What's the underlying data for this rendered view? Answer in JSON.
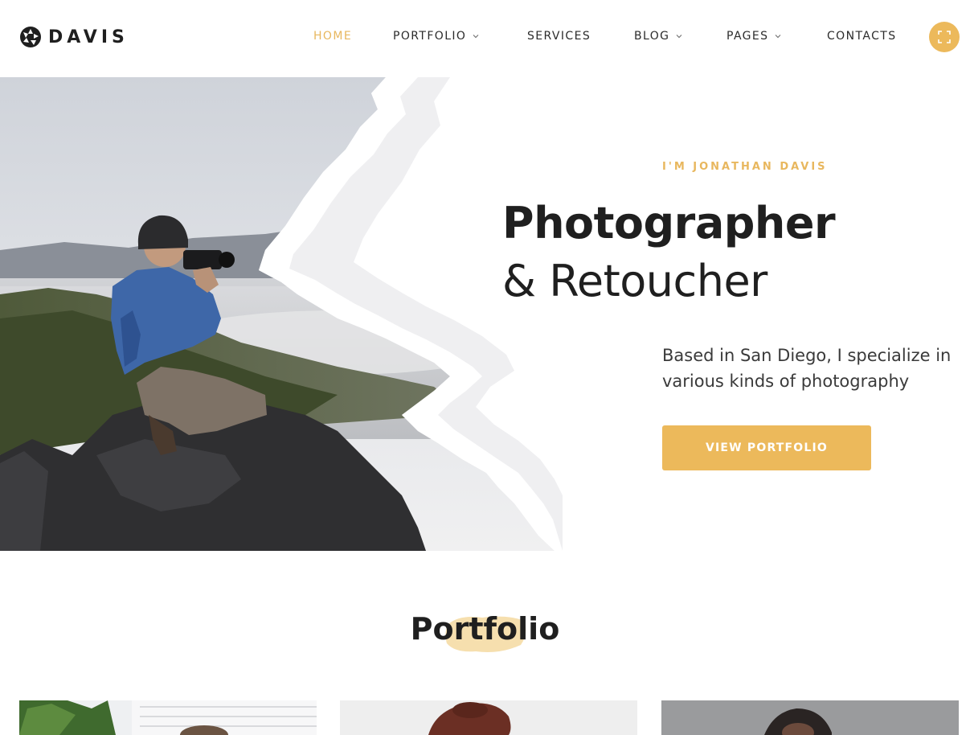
{
  "brand": {
    "name": "DAVIS"
  },
  "nav": {
    "items": [
      {
        "label": "HOME",
        "active": true,
        "dropdown": false
      },
      {
        "label": "PORTFOLIO",
        "active": false,
        "dropdown": true
      },
      {
        "label": "SERVICES",
        "active": false,
        "dropdown": false
      },
      {
        "label": "BLOG",
        "active": false,
        "dropdown": true
      },
      {
        "label": "PAGES",
        "active": false,
        "dropdown": true
      },
      {
        "label": "CONTACTS",
        "active": false,
        "dropdown": false
      }
    ],
    "fullscreen_icon": "fullscreen-icon"
  },
  "hero": {
    "eyebrow": "I'M JONATHAN DAVIS",
    "title_line1": "Photographer",
    "title_line2": "& Retoucher",
    "description": "Based in San Diego, I specialize in various kinds of photography",
    "cta_label": "VIEW PORTFOLIO"
  },
  "portfolio": {
    "heading": "Portfolio"
  },
  "colors": {
    "accent": "#ecb95b",
    "accent_text": "#e8b75e",
    "text_dark": "#1f1f1f",
    "text_body": "#3a3a3a"
  }
}
